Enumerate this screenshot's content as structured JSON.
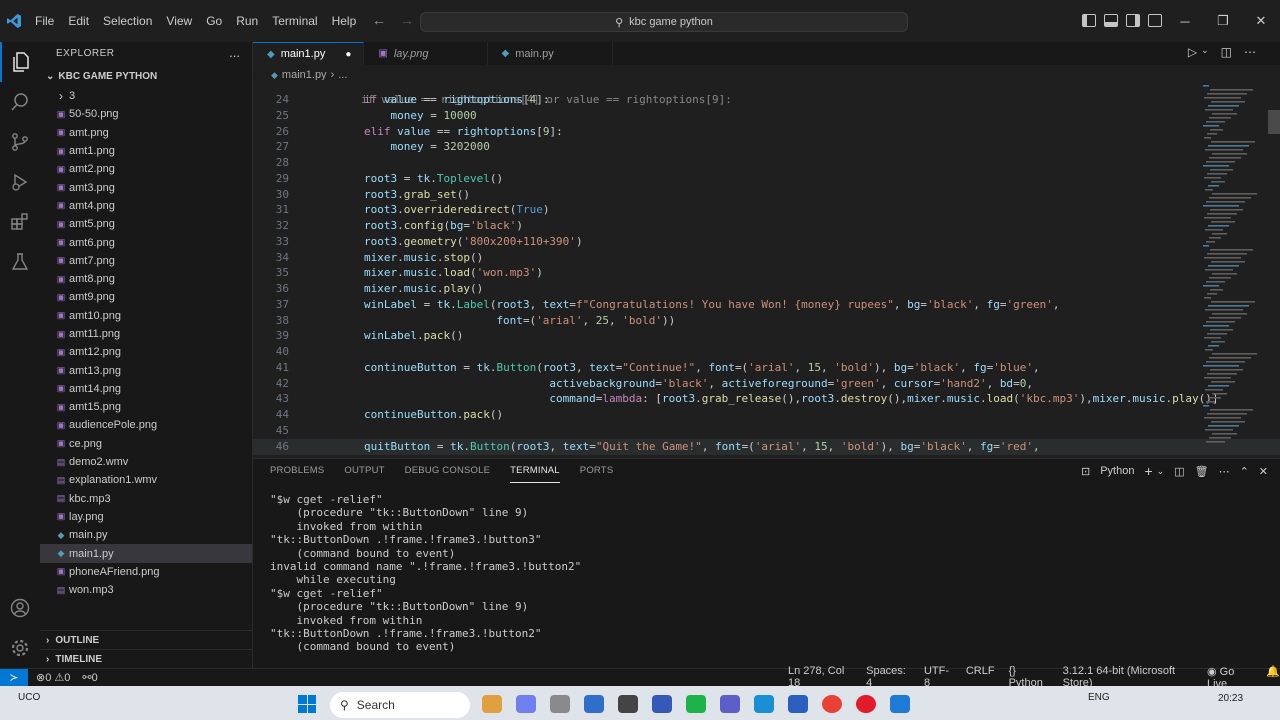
{
  "titlebar": {
    "menu": [
      "File",
      "Edit",
      "Selection",
      "View",
      "Go",
      "Run",
      "Terminal",
      "Help"
    ],
    "search": "kbc game python"
  },
  "sidebar": {
    "title": "EXPLORER",
    "more": "...",
    "folder": "KBC GAME PYTHON",
    "items": [
      {
        "name": "3",
        "type": "folder"
      },
      {
        "name": "50-50.png"
      },
      {
        "name": "amt.png"
      },
      {
        "name": "amt1.png"
      },
      {
        "name": "amt2.png"
      },
      {
        "name": "amt3.png"
      },
      {
        "name": "amt4.png"
      },
      {
        "name": "amt5.png"
      },
      {
        "name": "amt6.png"
      },
      {
        "name": "amt7.png"
      },
      {
        "name": "amt8.png"
      },
      {
        "name": "amt9.png"
      },
      {
        "name": "amt10.png"
      },
      {
        "name": "amt11.png"
      },
      {
        "name": "amt12.png"
      },
      {
        "name": "amt13.png"
      },
      {
        "name": "amt14.png"
      },
      {
        "name": "amt15.png"
      },
      {
        "name": "audiencePole.png"
      },
      {
        "name": "ce.png"
      },
      {
        "name": "demo2.wmv"
      },
      {
        "name": "explanation1.wmv"
      },
      {
        "name": "kbc.mp3"
      },
      {
        "name": "lay.png"
      },
      {
        "name": "main.py"
      },
      {
        "name": "main1.py",
        "selected": true
      },
      {
        "name": "phoneAFriend.png"
      },
      {
        "name": "won.mp3"
      }
    ],
    "outline": "OUTLINE",
    "timeline": "TIMELINE"
  },
  "tabs": [
    {
      "label": "main1.py",
      "active": true,
      "modified": "●"
    },
    {
      "label": "lay.png"
    },
    {
      "label": "main.py"
    }
  ],
  "breadcrumb": {
    "file": "main1.py",
    "rest": "..."
  },
  "editor": {
    "top_partial": "if value == rightoptions[4] or value == rightoptions[9]:",
    "lines": [
      {
        "n": "24",
        "text": "        if value == rightoptions[4]:"
      },
      {
        "n": "25",
        "text": "            money = 10000"
      },
      {
        "n": "26",
        "text": "        elif value == rightoptions[9]:"
      },
      {
        "n": "27",
        "text": "            money = 3202000"
      },
      {
        "n": "28",
        "text": ""
      },
      {
        "n": "29",
        "text": "        root3 = tk.Toplevel()"
      },
      {
        "n": "30",
        "text": "        root3.grab_set()"
      },
      {
        "n": "31",
        "text": "        root3.overrideredirect(True)"
      },
      {
        "n": "32",
        "text": "        root3.config(bg='black')"
      },
      {
        "n": "33",
        "text": "        root3.geometry('800x200+110+390')"
      },
      {
        "n": "34",
        "text": "        mixer.music.stop()"
      },
      {
        "n": "35",
        "text": "        mixer.music.load('won.mp3')"
      },
      {
        "n": "36",
        "text": "        mixer.music.play()"
      },
      {
        "n": "37",
        "text": "        winLabel = tk.Label(root3, text=f\"Congratulations! You have Won! {money} rupees\", bg='black', fg='green',"
      },
      {
        "n": "38",
        "text": "                            font=('arial', 25, 'bold'))"
      },
      {
        "n": "39",
        "text": "        winLabel.pack()"
      },
      {
        "n": "40",
        "text": ""
      },
      {
        "n": "41",
        "text": "        continueButton = tk.Button(root3, text=\"Continue!\", font=('arial', 15, 'bold'), bg='black', fg='blue',"
      },
      {
        "n": "42",
        "text": "                                    activebackground='black', activeforeground='green', cursor='hand2', bd=0,"
      },
      {
        "n": "43",
        "text": "                                    command=lambda: [root3.grab_release(),root3.destroy(),mixer.music.load('kbc.mp3'),mixer.music.play()]"
      },
      {
        "n": "44",
        "text": "        continueButton.pack()"
      },
      {
        "n": "45",
        "text": ""
      },
      {
        "n": "46",
        "text": "        quitButton = tk.Button(root3, text=\"Quit the Game!\", font=('arial', 15, 'bold'), bg='black', fg='red',"
      }
    ]
  },
  "panel": {
    "tabs": [
      "PROBLEMS",
      "OUTPUT",
      "DEBUG CONSOLE",
      "TERMINAL",
      "PORTS"
    ],
    "active_tab": "TERMINAL",
    "shell": "Python",
    "terminal_lines": [
      "\"$w cget -relief\"",
      "    (procedure \"tk::ButtonDown\" line 9)",
      "    invoked from within",
      "\"tk::ButtonDown .!frame.!frame3.!button3\"",
      "    (command bound to event)",
      "invalid command name \".!frame.!frame3.!button2\"",
      "    while executing",
      "\"$w cget -relief\"",
      "    (procedure \"tk::ButtonDown\" line 9)",
      "    invoked from within",
      "\"tk::ButtonDown .!frame.!frame3.!button2\"",
      "    (command bound to event)"
    ]
  },
  "statusbar": {
    "errors": "0",
    "warnings": "0",
    "ports": "0",
    "position": "Ln 278, Col 18",
    "spaces": "Spaces: 4",
    "encoding": "UTF-8",
    "eol": "CRLF",
    "language": "Python",
    "interpreter": "3.12.1 64-bit (Microsoft Store)",
    "golive": "Go Live"
  },
  "taskbar": {
    "weather": "UCO",
    "search": "Search",
    "lang": "ENG",
    "time": "20:23"
  },
  "colors": {
    "accent": "#0078d4",
    "background": "#1e1e1e"
  }
}
